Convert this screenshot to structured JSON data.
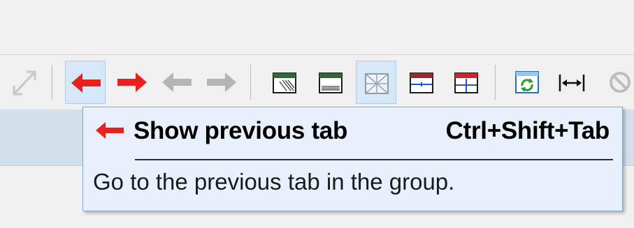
{
  "toolbar": {
    "buttons": [
      {
        "icon": "maximize-view-icon",
        "state": "disabled"
      },
      {
        "icon": "previous-tab-arrow-icon",
        "state": "hover",
        "color": "#e8211f"
      },
      {
        "icon": "next-tab-arrow-icon",
        "state": "enabled",
        "color": "#e8211f"
      },
      {
        "icon": "back-arrow-icon",
        "state": "disabled",
        "color": "#b4b4b4"
      },
      {
        "icon": "forward-arrow-icon",
        "state": "disabled",
        "color": "#b4b4b4"
      },
      {
        "icon": "layout-pane-pattern-icon"
      },
      {
        "icon": "layout-pane-dotted-icon"
      },
      {
        "icon": "layout-diagonal-grid-icon",
        "state": "active"
      },
      {
        "icon": "split-horizontal-icon"
      },
      {
        "icon": "split-grid-icon"
      },
      {
        "icon": "refresh-window-icon"
      },
      {
        "icon": "fit-width-icon"
      },
      {
        "icon": "cancel-icon",
        "state": "disabled"
      }
    ]
  },
  "tooltip": {
    "icon": "previous-tab-arrow-icon",
    "title": "Show previous tab",
    "shortcut": "Ctrl+Shift+Tab",
    "description": "Go to the previous tab in the group."
  },
  "colors": {
    "arrow_red": "#e8211f",
    "arrow_disabled": "#b4b4b4",
    "tooltip_bg": "#e8f1fb",
    "hover_bg": "#d6e8f8"
  }
}
